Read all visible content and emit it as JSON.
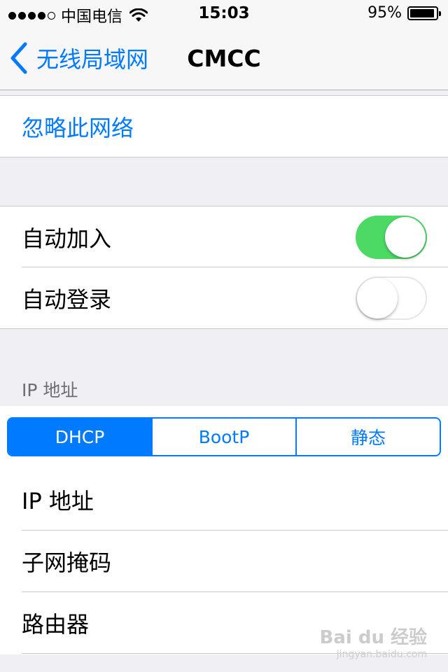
{
  "status_bar": {
    "carrier": "中国电信",
    "signal_dots_filled": 4,
    "signal_dots_total": 5,
    "time": "15:03",
    "battery_percent_label": "95%",
    "battery_level": 0.95
  },
  "nav": {
    "back_label": "无线局域网",
    "title": "CMCC"
  },
  "forget": {
    "label": "忽略此网络"
  },
  "toggles": {
    "auto_join": {
      "label": "自动加入",
      "on": true
    },
    "auto_login": {
      "label": "自动登录",
      "on": false
    }
  },
  "ip_section": {
    "header": "IP 地址",
    "segments": [
      "DHCP",
      "BootP",
      "静态"
    ],
    "selected": "DHCP",
    "rows": [
      "IP 地址",
      "子网掩码",
      "路由器"
    ]
  },
  "watermark": {
    "brand": "Bai du 经验",
    "url": "jingyan.baidu.com"
  },
  "colors": {
    "accent": "#007aff",
    "toggle_on": "#4cd964",
    "background": "#efeff4"
  }
}
